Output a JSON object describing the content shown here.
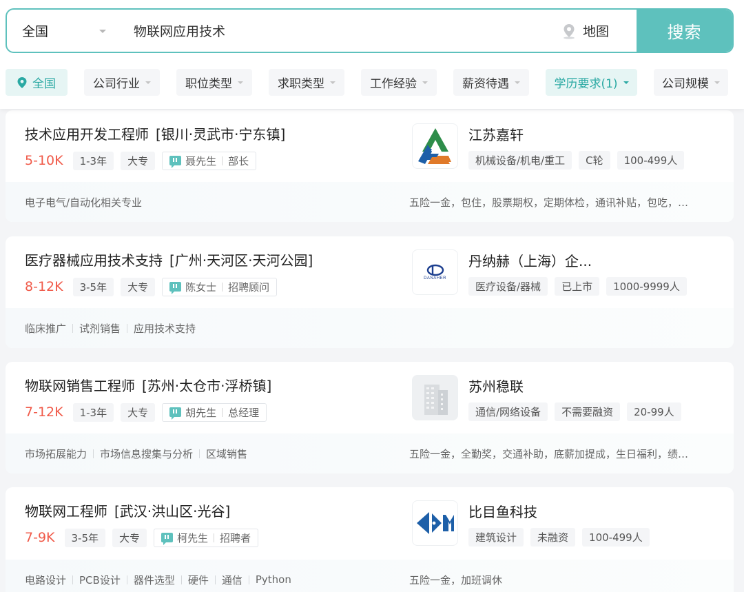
{
  "search": {
    "city": "全国",
    "keyword": "物联网应用技术",
    "map_label": "地图",
    "button_label": "搜索"
  },
  "filters": [
    {
      "label": "全国"
    },
    {
      "label": "公司行业"
    },
    {
      "label": "职位类型"
    },
    {
      "label": "求职类型"
    },
    {
      "label": "工作经验"
    },
    {
      "label": "薪资待遇"
    },
    {
      "label": "学历要求(1)"
    },
    {
      "label": "公司规模"
    }
  ],
  "jobs": [
    {
      "title": "技术应用开发工程师",
      "location": "[银川·灵武市·宁东镇]",
      "salary": "5-10K",
      "experience": "1-3年",
      "education": "大专",
      "recruiter_name": "聂先生",
      "recruiter_role": "部长",
      "company": "江苏嘉轩",
      "company_tags": [
        "机械设备/机电/重工",
        "C轮",
        "100-499人"
      ],
      "skills": [
        "电子电气/自动化相关专业"
      ],
      "benefits": "五险一金，包住，股票期权，定期体检，通讯补贴，包吃，…"
    },
    {
      "title": "医疗器械应用技术支持",
      "location": "[广州·天河区·天河公园]",
      "salary": "8-12K",
      "experience": "3-5年",
      "education": "大专",
      "recruiter_name": "陈女士",
      "recruiter_role": "招聘顾问",
      "company": "丹纳赫（上海）企...",
      "company_logo_text": "DANAHER",
      "company_tags": [
        "医疗设备/器械",
        "已上市",
        "1000-9999人"
      ],
      "skills": [
        "临床推广",
        "试剂销售",
        "应用技术支持"
      ],
      "benefits": ""
    },
    {
      "title": "物联网销售工程师",
      "location": "[苏州·太仓市·浮桥镇]",
      "salary": "7-12K",
      "experience": "1-3年",
      "education": "大专",
      "recruiter_name": "胡先生",
      "recruiter_role": "总经理",
      "company": "苏州稳联",
      "company_tags": [
        "通信/网络设备",
        "不需要融资",
        "20-99人"
      ],
      "skills": [
        "市场拓展能力",
        "市场信息搜集与分析",
        "区域销售"
      ],
      "benefits": "五险一金，全勤奖，交通补助，底薪加提成，生日福利，绩…"
    },
    {
      "title": "物联网工程师",
      "location": "[武汉·洪山区·光谷]",
      "salary": "7-9K",
      "experience": "3-5年",
      "education": "大专",
      "recruiter_name": "柯先生",
      "recruiter_role": "招聘者",
      "company": "比目鱼科技",
      "company_tags": [
        "建筑设计",
        "未融资",
        "100-499人"
      ],
      "skills": [
        "电路设计",
        "PCB设计",
        "器件选型",
        "硬件",
        "通信",
        "Python"
      ],
      "benefits": "五险一金，加班调休"
    }
  ],
  "colors": {
    "accent": "#5ec1bd",
    "salary": "#f05a49",
    "active_chip_bg": "#e6f5f4",
    "active_chip_text": "#2aa9a3"
  }
}
